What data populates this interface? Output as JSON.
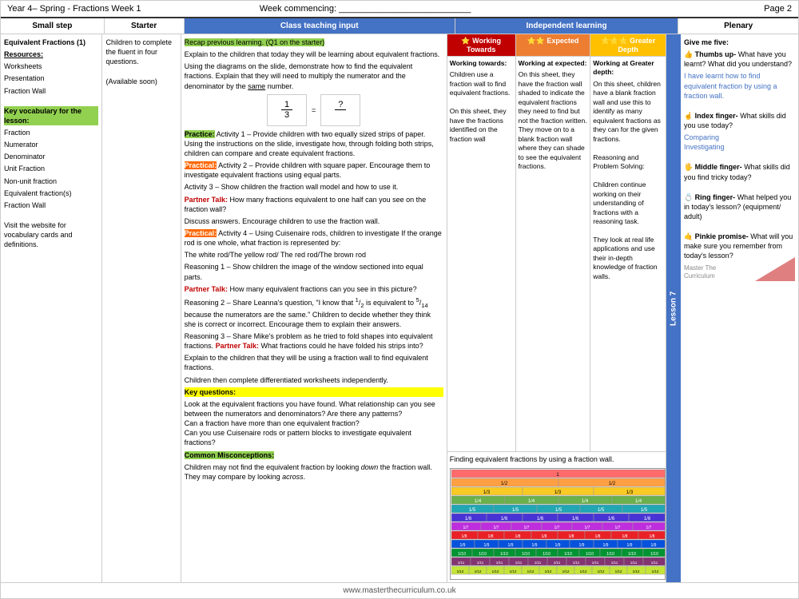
{
  "header": {
    "title": "Year 4– Spring - Fractions Week 1",
    "week": "Week commencing: ___________________________",
    "page": "Page 2"
  },
  "columns": {
    "small_step": "Small step",
    "starter": "Starter",
    "teaching": "Class teaching input",
    "independent": "Independent learning",
    "plenary": "Plenary"
  },
  "small_step": {
    "title": "Equivalent Fractions (1)",
    "resources_label": "Resources:",
    "resources": [
      "Worksheets",
      "Presentation",
      "Fraction Wall"
    ],
    "vocab_label": "Key vocabulary for the lesson:",
    "vocab": [
      "Fraction",
      "Numerator",
      "Denominator",
      "Unit Fraction",
      "Non-unit fraction",
      "Equivalent fraction(s)",
      "Fraction Wall"
    ],
    "website_text": "Visit the website for vocabulary cards and definitions."
  },
  "starter": {
    "text": "Children to complete the fluent in four questions.",
    "available": "(Available soon)"
  },
  "teaching": {
    "recap": "Recap previous learning. (Q1 on the starter)",
    "intro": "Explain to  the children that today they will be learning about equivalent fractions.",
    "using_diagrams": "Using the diagrams on the slide, demonstrate how to find the equivalent fractions. Explain that they will need to multiply the numerator and the denominator by the",
    "same": "same",
    "same_end": "number.",
    "practice1_label": "Practice:",
    "practice1": "Activity 1 – Provide children with two equally sized strips of paper. Using the instructions on the slide, investigate how, through folding both strips, children can compare and create equivalent fractions.",
    "practical2_label": "Practical:",
    "practical2": "Activity 2 – Provide children with square paper. Encourage them to investigate equivalent fractions using equal parts.",
    "activity3": "Activity 3 – Show children the fraction wall model and how to use it.",
    "partner_talk1": "Partner Talk:",
    "partner_talk1_text": "How many fractions equivalent to one half can you see on the fraction wall?",
    "discuss": "Discuss answers. Encourage children to use the fraction wall.",
    "practical4_label": "Practical:",
    "practical4": "Activity 4 – Using Cuisenaire rods,  children to investigate If the orange rod is one whole, what fraction is represented by:",
    "rods": "The white rod/The yellow rod/ The red rod/The brown rod",
    "reasoning1": "Reasoning 1 – Show children the image of the window sectioned into equal parts.",
    "partner_talk2": "Partner Talk:",
    "partner_talk2_text": "How many equivalent fractions can you see in this picture?",
    "reasoning2_start": "Reasoning 2 – Share Leanna's question, \"I know that",
    "reasoning2_frac1_num": "1",
    "reasoning2_frac1_den": "2",
    "reasoning2_mid": "is equivalent to",
    "reasoning2_frac2_num": "5",
    "reasoning2_frac2_den": "14",
    "reasoning2_end": "because the numerators are the same.\" Children to decide whether they think she is correct or incorrect. Encourage them to explain their answers.",
    "reasoning3": "Reasoning 3 – Share Mike's problem as he tried to fold shapes into equivalent fractions.",
    "partner_talk3": "Partner Talk:",
    "partner_talk3_text": "What fractions could he have folded his strips into?",
    "explain_fraction_wall": "Explain to the children that they will be using a fraction wall to find equivalent fractions.",
    "differentiated": "Children then complete differentiated worksheets independently.",
    "key_questions_label": "Key questions:",
    "key_questions": "Look at the equivalent fractions you have found. What relationship can you see between the numerators and denominators? Are there any patterns?\nCan a fraction have more than one equivalent fraction?\nCan you use Cuisenaire rods or pattern blocks to investigate equivalent fractions?",
    "misconceptions_label": "Common Misconceptions:",
    "misconceptions": "Children may not find the equivalent fraction by looking down the fraction wall. They may compare by looking across."
  },
  "independent": {
    "working_header": "Working Towards",
    "expected_header": "Expected",
    "greater_header": "Greater Depth",
    "working_star": "⭐",
    "expected_stars": "⭐⭐",
    "greater_stars": "⭐⭐⭐",
    "working_title": "Working towards:",
    "expected_title": "Working at expected:",
    "greater_title": "Working at Greater depth:",
    "working_text": "Children use a fraction wall to find equivalent fractions.\n\nOn this sheet, they have the fractions identified on the fraction wall",
    "expected_text": "On this sheet, they have the fraction wall shaded to indicate the equivalent fractions they need to find but not the fraction written. They move on to a blank fraction wall where they can shade to see the equivalent fractions.",
    "greater_text": "On this sheet, children have a blank fraction wall and use this to identify as many equivalent fractions as they can for the given fractions.\n\nReasoning and Problem Solving:\n\nChildren continue working on their understanding of fractions with a reasoning task.\n\nThey look at real life applications and use their in-depth knowledge of fraction walls.",
    "bottom_text": "Finding equivalent fractions by using a fraction wall.",
    "fraction_wall_rows": [
      {
        "label": "1",
        "cells": 1,
        "color": "#FF6B6B"
      },
      {
        "label": "1/2",
        "cells": 2,
        "color": "#FF9F43"
      },
      {
        "label": "1/3",
        "cells": 3,
        "color": "#F9CA24"
      },
      {
        "label": "1/4",
        "cells": 4,
        "color": "#6AB04C"
      },
      {
        "label": "1/5",
        "cells": 5,
        "color": "#22A6B3"
      },
      {
        "label": "1/6",
        "cells": 6,
        "color": "#4834D4"
      },
      {
        "label": "1/7",
        "cells": 7,
        "color": "#BE2EDD"
      },
      {
        "label": "1/8",
        "cells": 8,
        "color": "#EA2027"
      },
      {
        "label": "1/9",
        "cells": 9,
        "color": "#0652DD"
      },
      {
        "label": "1/10",
        "cells": 10,
        "color": "#009432"
      },
      {
        "label": "1/11",
        "cells": 11,
        "color": "#833471"
      },
      {
        "label": "1/12",
        "cells": 12,
        "color": "#C4E538"
      }
    ]
  },
  "plenary": {
    "intro": "Give me five:",
    "thumb_icon": "👍",
    "thumb_label": "Thumbs up-",
    "thumb_text": "What have you learnt? What did you understand?",
    "thumb_response": "I have learnt how to find equivalent fraction by using a fraction wall.",
    "index_icon": "☝",
    "index_label": "Index finger-",
    "index_text": "What skills did you use today?",
    "index_skills": "Comparing\nInvestigating",
    "middle_icon": "🖐",
    "middle_label": "Middle finger-",
    "middle_text": "What skills did you find tricky today?",
    "ring_icon": "💍",
    "ring_label": "Ring finger-",
    "ring_text": "What helped you in today's lesson? (equipment/ adult)",
    "pinkie_icon": "🤙",
    "pinkie_label": "Pinkie promise-",
    "pinkie_text": "What will you make sure you remember from today's lesson?"
  },
  "footer": {
    "url": "www.masterthecurriculum.co.uk"
  },
  "lesson_label": "Lesson 7"
}
